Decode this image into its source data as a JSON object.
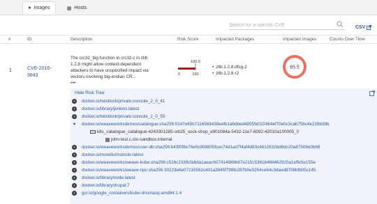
{
  "tabs": [
    {
      "label": "Images",
      "icon": "circle-icon",
      "active": true
    },
    {
      "label": "Hosts",
      "icon": "host-icon",
      "active": false
    }
  ],
  "search": {
    "placeholder": "Search for a specific CVE"
  },
  "csv_label": "CSV",
  "table": {
    "headers": [
      "#",
      "ID",
      "Description",
      "Risk Score",
      "Impacted Packages",
      "Impacted Images",
      "Counts Over Time"
    ]
  },
  "row": {
    "number": "1",
    "cve_id_line1": "CVE-2016-",
    "cve_id_line2": "9843",
    "description_lines": [
      "The crc32_big function in crc32.c in zlib",
      "1.2.8 might allow context-dependent",
      "attackers to have unspecified impact via",
      "vectors involving big-endian CR..."
    ],
    "description_more": "•••",
    "risk_score": {
      "value": "100.0",
      "min": "0",
      "max": "100",
      "fill_fraction": 1.0,
      "color": "#a31c1c"
    },
    "packages": [
      "zlib:1.2.8.dfsg-2",
      "zlib:1.2.8-r2"
    ],
    "impacted_images": {
      "value": "65.5",
      "color": "#e57368"
    }
  },
  "risk_tree": {
    "hide_label": "Hide Risk Tree",
    "items": [
      {
        "type": "image",
        "bullet": "+",
        "text": "docker.io/twistlock/private:console_2_0_41"
      },
      {
        "type": "image",
        "bullet": "+",
        "text": "docker.io/library/jenkins:latest"
      },
      {
        "type": "image",
        "bullet": "+",
        "text": "docker.io/twistlock/private:console_2_0_55"
      },
      {
        "type": "image",
        "bullet": "▼",
        "text": "docker.io/weaveworksdemos/catalogue:sha256:0147e65b7116569439eefb1a6dbed4855fe022464ef70e0c3cab75bc4e226b39b"
      },
      {
        "type": "container",
        "text": "k8s_catalogue_catalogue-4243301285-srb25_sock-shop_e901084a-5432-11e7-8092-42010a100005_0"
      },
      {
        "type": "host",
        "text": "john-test.c.cto-sandbox.internal"
      },
      {
        "type": "image",
        "bullet": "+",
        "text": "docker.io/weaveworksdemos/user-db:sha256:b43f0f8e76e0c908805fcec74d1ad7f4af4d93c4612632bd6dc20a87508e0b68"
      },
      {
        "type": "image",
        "bullet": "+",
        "text": "docker.io/morello/motools:latest"
      },
      {
        "type": "image",
        "bullet": "+",
        "text": "docker.io/weaveworks/weave-kube:sha256:c51bc2339cfa6da1aeac607414989b87e215c5361b468462920a1effe5e155e"
      },
      {
        "type": "image",
        "bullet": "+",
        "text": "docker.io/weaveworks/weave-npc:sha256:30223e6e07215562c401a3845f798fe287b0e0254ce64c3daed8708bfb05c145"
      },
      {
        "type": "image",
        "bullet": "+",
        "text": "docker.io/library/node:latest"
      },
      {
        "type": "image",
        "bullet": "+",
        "text": "docker.io/library/drupal:7"
      },
      {
        "type": "image",
        "bullet": "+",
        "text": "gcr.io/google_containers/kube-dnsmasq-amd64:1.4"
      }
    ]
  }
}
